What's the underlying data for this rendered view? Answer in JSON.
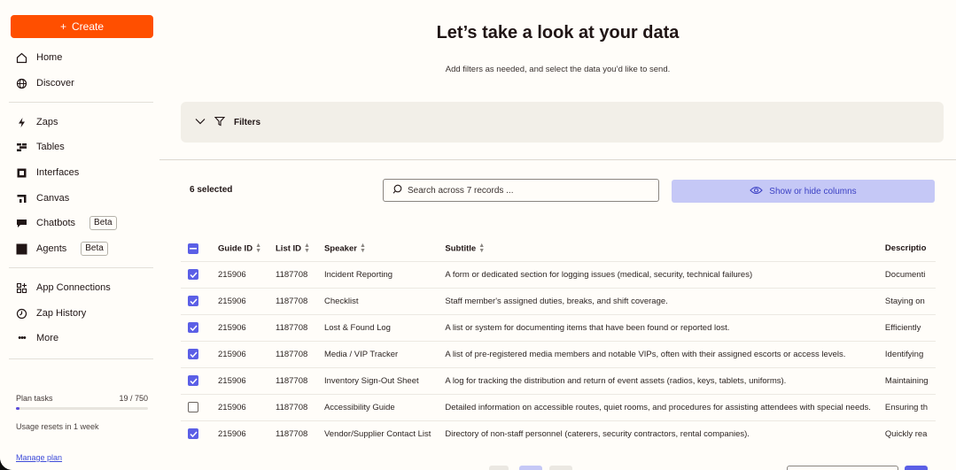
{
  "sidebar": {
    "create_label": "Create",
    "items": [
      {
        "label": "Home",
        "icon": "home-icon"
      },
      {
        "label": "Discover",
        "icon": "globe-icon"
      },
      {
        "label": "Zaps",
        "icon": "lightning-icon"
      },
      {
        "label": "Tables",
        "icon": "tables-icon"
      },
      {
        "label": "Interfaces",
        "icon": "interfaces-icon"
      },
      {
        "label": "Canvas",
        "icon": "canvas-icon"
      },
      {
        "label": "Chatbots",
        "icon": "chatbot-icon",
        "badge": "Beta"
      },
      {
        "label": "Agents",
        "icon": "agents-icon",
        "badge": "Beta"
      },
      {
        "label": "App Connections",
        "icon": "app-connections-icon"
      },
      {
        "label": "Zap History",
        "icon": "history-icon"
      },
      {
        "label": "More",
        "icon": "more-icon"
      }
    ],
    "plan": {
      "label": "Plan tasks",
      "count": "19 / 750",
      "progress": 0.025,
      "usage_text": "Usage resets in 1 week",
      "manage_label": "Manage plan"
    }
  },
  "main": {
    "title": "Let’s take a look at your data",
    "subtitle": "Add filters as needed, and select the data you’d like to send.",
    "filters_label": "Filters",
    "selected_text": "6 selected",
    "search_placeholder": "Search across 7 records ...",
    "show_hide_label": "Show or hide columns",
    "accent_color": "#ff4f00",
    "checkbox_color": "#5b5fe6",
    "table": {
      "columns": [
        "Guide ID",
        "List ID",
        "Speaker",
        "Subtitle",
        "Descriptio"
      ],
      "rows": [
        {
          "checked": true,
          "guide_id": "215906",
          "list_id": "1187708",
          "speaker": "Incident Reporting",
          "subtitle": "A form or dedicated section for logging issues (medical, security, technical failures)",
          "description": "Documenti"
        },
        {
          "checked": true,
          "guide_id": "215906",
          "list_id": "1187708",
          "speaker": "Checklist",
          "subtitle": "Staff member's assigned duties, breaks, and shift coverage.",
          "description": "Staying on"
        },
        {
          "checked": true,
          "guide_id": "215906",
          "list_id": "1187708",
          "speaker": "Lost & Found Log",
          "subtitle": "A list or system for documenting items that have been found or reported lost.",
          "description": "Efficiently"
        },
        {
          "checked": true,
          "guide_id": "215906",
          "list_id": "1187708",
          "speaker": "Media / VIP Tracker",
          "subtitle": "A list of pre-registered media members and notable VIPs, often with their assigned escorts or access levels.",
          "description": "Identifying"
        },
        {
          "checked": true,
          "guide_id": "215906",
          "list_id": "1187708",
          "speaker": "Inventory Sign-Out Sheet",
          "subtitle": "A log for tracking the distribution and return of event assets (radios, keys, tablets, uniforms).",
          "description": "Maintaining"
        },
        {
          "checked": false,
          "guide_id": "215906",
          "list_id": "1187708",
          "speaker": "Accessibility Guide",
          "subtitle": "Detailed information on accessible routes, quiet rooms, and procedures for assisting attendees with special needs.",
          "description": "Ensuring th"
        },
        {
          "checked": true,
          "guide_id": "215906",
          "list_id": "1187708",
          "speaker": "Vendor/Supplier Contact List",
          "subtitle": "Directory of non-staff personnel (caterers, security contractors, rental companies).",
          "description": "Quickly rea"
        }
      ]
    }
  }
}
